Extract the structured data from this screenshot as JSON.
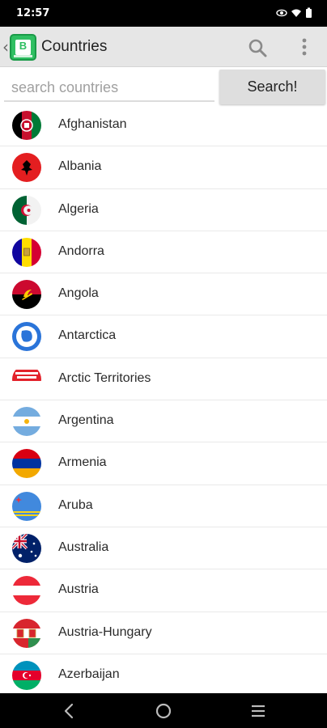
{
  "status_bar": {
    "time": "12:57"
  },
  "app_bar": {
    "title": "Countries",
    "logo_letter": "B",
    "icons": [
      "back-chevron-icon",
      "search-icon",
      "overflow-menu-icon"
    ]
  },
  "search": {
    "placeholder": "search countries",
    "value": "",
    "button_label": "Search!"
  },
  "countries": [
    {
      "name": "Afghanistan",
      "flag": "afghanistan-flag-icon"
    },
    {
      "name": "Albania",
      "flag": "albania-flag-icon"
    },
    {
      "name": "Algeria",
      "flag": "algeria-flag-icon"
    },
    {
      "name": "Andorra",
      "flag": "andorra-flag-icon"
    },
    {
      "name": "Angola",
      "flag": "angola-flag-icon"
    },
    {
      "name": "Antarctica",
      "flag": "antarctica-flag-icon"
    },
    {
      "name": "Arctic Territories",
      "flag": "arctic-territories-flag-icon"
    },
    {
      "name": "Argentina",
      "flag": "argentina-flag-icon"
    },
    {
      "name": "Armenia",
      "flag": "armenia-flag-icon"
    },
    {
      "name": "Aruba",
      "flag": "aruba-flag-icon"
    },
    {
      "name": "Australia",
      "flag": "australia-flag-icon"
    },
    {
      "name": "Austria",
      "flag": "austria-flag-icon"
    },
    {
      "name": "Austria-Hungary",
      "flag": "austria-hungary-flag-icon"
    },
    {
      "name": "Azerbaijan",
      "flag": "azerbaijan-flag-icon"
    }
  ],
  "nav_bar": {
    "icons": [
      "back-nav-icon",
      "home-nav-icon",
      "recents-nav-icon"
    ]
  },
  "colors": {
    "app_bar": "#e6e6e6",
    "logo": "#2fbf62",
    "status_bar": "#000000"
  }
}
